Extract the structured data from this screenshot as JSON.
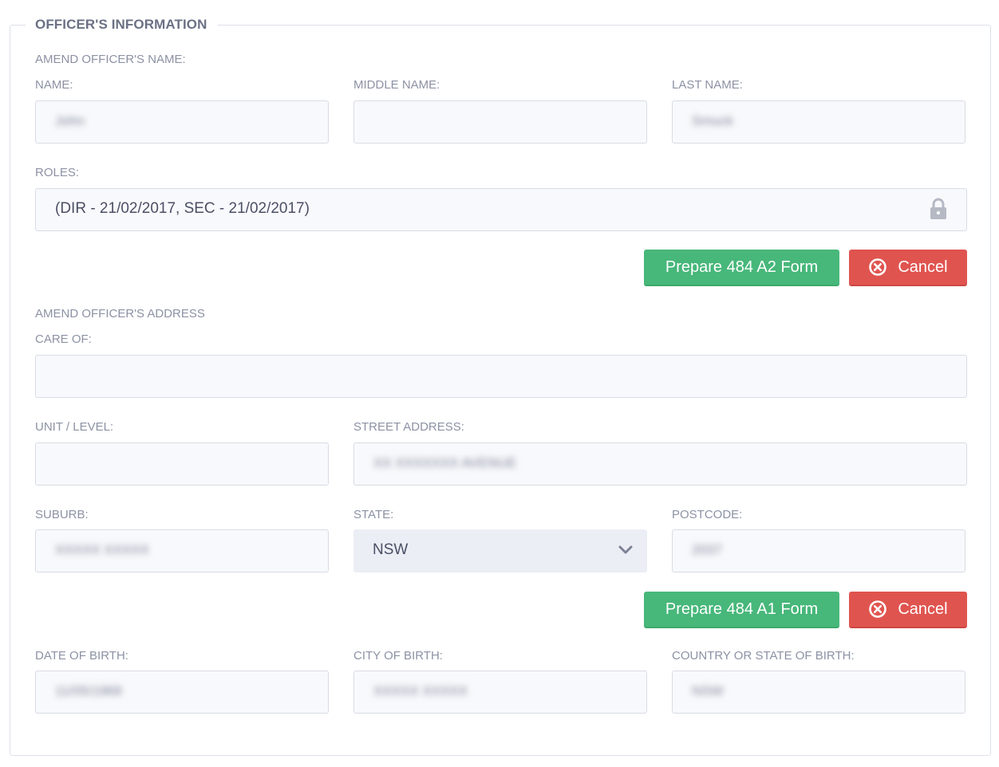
{
  "section": {
    "legend": "OFFICER'S INFORMATION"
  },
  "name_section": {
    "heading": "AMEND OFFICER'S NAME:",
    "first_name_label": "NAME:",
    "first_name_value": "John",
    "middle_name_label": "MIDDLE NAME:",
    "middle_name_value": "",
    "last_name_label": "LAST NAME:",
    "last_name_value": "Smuck",
    "roles_label": "ROLES:",
    "roles_value": "(DIR - 21/02/2017, SEC - 21/02/2017)",
    "roles_icon": "lock-icon",
    "prepare_button": "Prepare 484 A2 Form",
    "cancel_button": "Cancel",
    "cancel_icon": "close-circle-icon"
  },
  "address_section": {
    "heading": "AMEND OFFICER'S ADDRESS",
    "care_of_label": "CARE OF:",
    "care_of_value": "",
    "unit_label": "UNIT / LEVEL:",
    "unit_value": "",
    "street_label": "STREET ADDRESS:",
    "street_value": "XX XXXXXXX AVENUE",
    "suburb_label": "SUBURB:",
    "suburb_value": "XXXXX XXXXX",
    "state_label": "STATE:",
    "state_value": "NSW",
    "postcode_label": "POSTCODE:",
    "postcode_value": "2037",
    "prepare_button": "Prepare 484 A1 Form",
    "cancel_button": "Cancel",
    "cancel_icon": "close-circle-icon"
  },
  "birth_section": {
    "dob_label": "DATE OF BIRTH:",
    "dob_value": "11/05/1968",
    "city_label": "CITY OF BIRTH:",
    "city_value": "XXXXX XXXXX",
    "country_label": "COUNTRY OR STATE OF BIRTH:",
    "country_value": "NSW"
  },
  "colors": {
    "accent_green": "#47b77a",
    "danger_red": "#e0544f",
    "input_bg": "#f8f9fc",
    "border": "#d9dce6"
  }
}
